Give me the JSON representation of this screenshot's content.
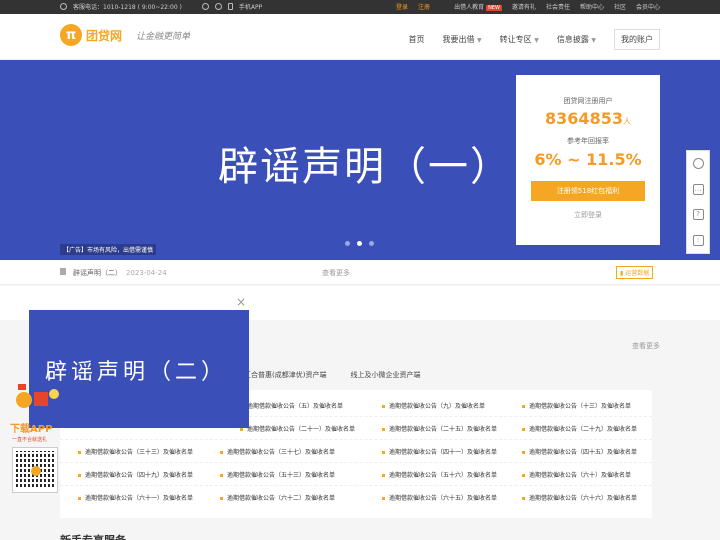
{
  "topbar": {
    "hotline": "客服电话：1010-1218 ( 9:00~22:00 )",
    "mobile_app": "手机APP",
    "login": "登录",
    "register": "注册",
    "lender_edu": "出借人教育",
    "new_badge": "NEW",
    "invite": "邀请有礼",
    "social": "社会责任",
    "help": "帮助中心",
    "community": "社区",
    "member": "会员中心"
  },
  "header": {
    "logo_mark": "π",
    "logo_text": "团贷网",
    "slogan": "让金融更简单",
    "nav": [
      "首页",
      "我要出借",
      "转让专区",
      "信息披露"
    ],
    "account": "我的账户"
  },
  "banner": {
    "title": "辟谣声明（一）",
    "ad_note": "【广告】市场有风险，出借需谨慎",
    "slide_count": 3,
    "active_slide": 2
  },
  "signup_card": {
    "users_label": "团贷网注册用户",
    "users_count": "8364853",
    "users_unit": "人",
    "rate_label": "参考年回报率",
    "rate_value": "6% ~ 11.5%",
    "cta": "注册领518红包福利",
    "login_link": "立即登录"
  },
  "notice": {
    "text": "辟谣声明（二）",
    "date": "2023-04-24",
    "more": "查看更多",
    "ops_data": "运营数据"
  },
  "content": {
    "see_more": "查看更多",
    "tabs": [
      "汇合普惠(成都津优)资产端",
      "线上及小微企业资产端"
    ],
    "rows": [
      [
        "逾期借款催收公告（五）及催收名单",
        "逾期借款催收公告（九）及催收名单",
        "逾期借款催收公告（十三）及催收名单"
      ],
      [
        "逾期借款催收公告（二十一）及催收名单",
        "逾期借款催收公告（二十五）及催收名单",
        "逾期借款催收公告（二十九）及催收名单"
      ],
      [
        "逾期借款催收公告（三十三）及催收名单",
        "逾期借款催收公告（三十七）及催收名单",
        "逾期借款催收公告（四十一）及催收名单",
        "逾期借款催收公告（四十五）及催收名单"
      ],
      [
        "逾期借款催收公告（四十九）及催收名单",
        "逾期借款催收公告（五十三）及催收名单",
        "逾期借款催收公告（五十六）及催收名单",
        "逾期借款催收公告（六十）及催收名单"
      ],
      [
        "逾期借款催收公告（六十一）及催收名单",
        "逾期借款催收公告（六十二）及催收名单",
        "逾期借款催收公告（六十五）及催收名单",
        "逾期借款催收公告（六十六）及催收名单"
      ]
    ],
    "bottom_title": "新手专享服务"
  },
  "popup": {
    "title": "辟谣声明（二）",
    "close": "×"
  },
  "app_float": {
    "title": "下载APP",
    "subtitle": "一直不合就送礼"
  }
}
